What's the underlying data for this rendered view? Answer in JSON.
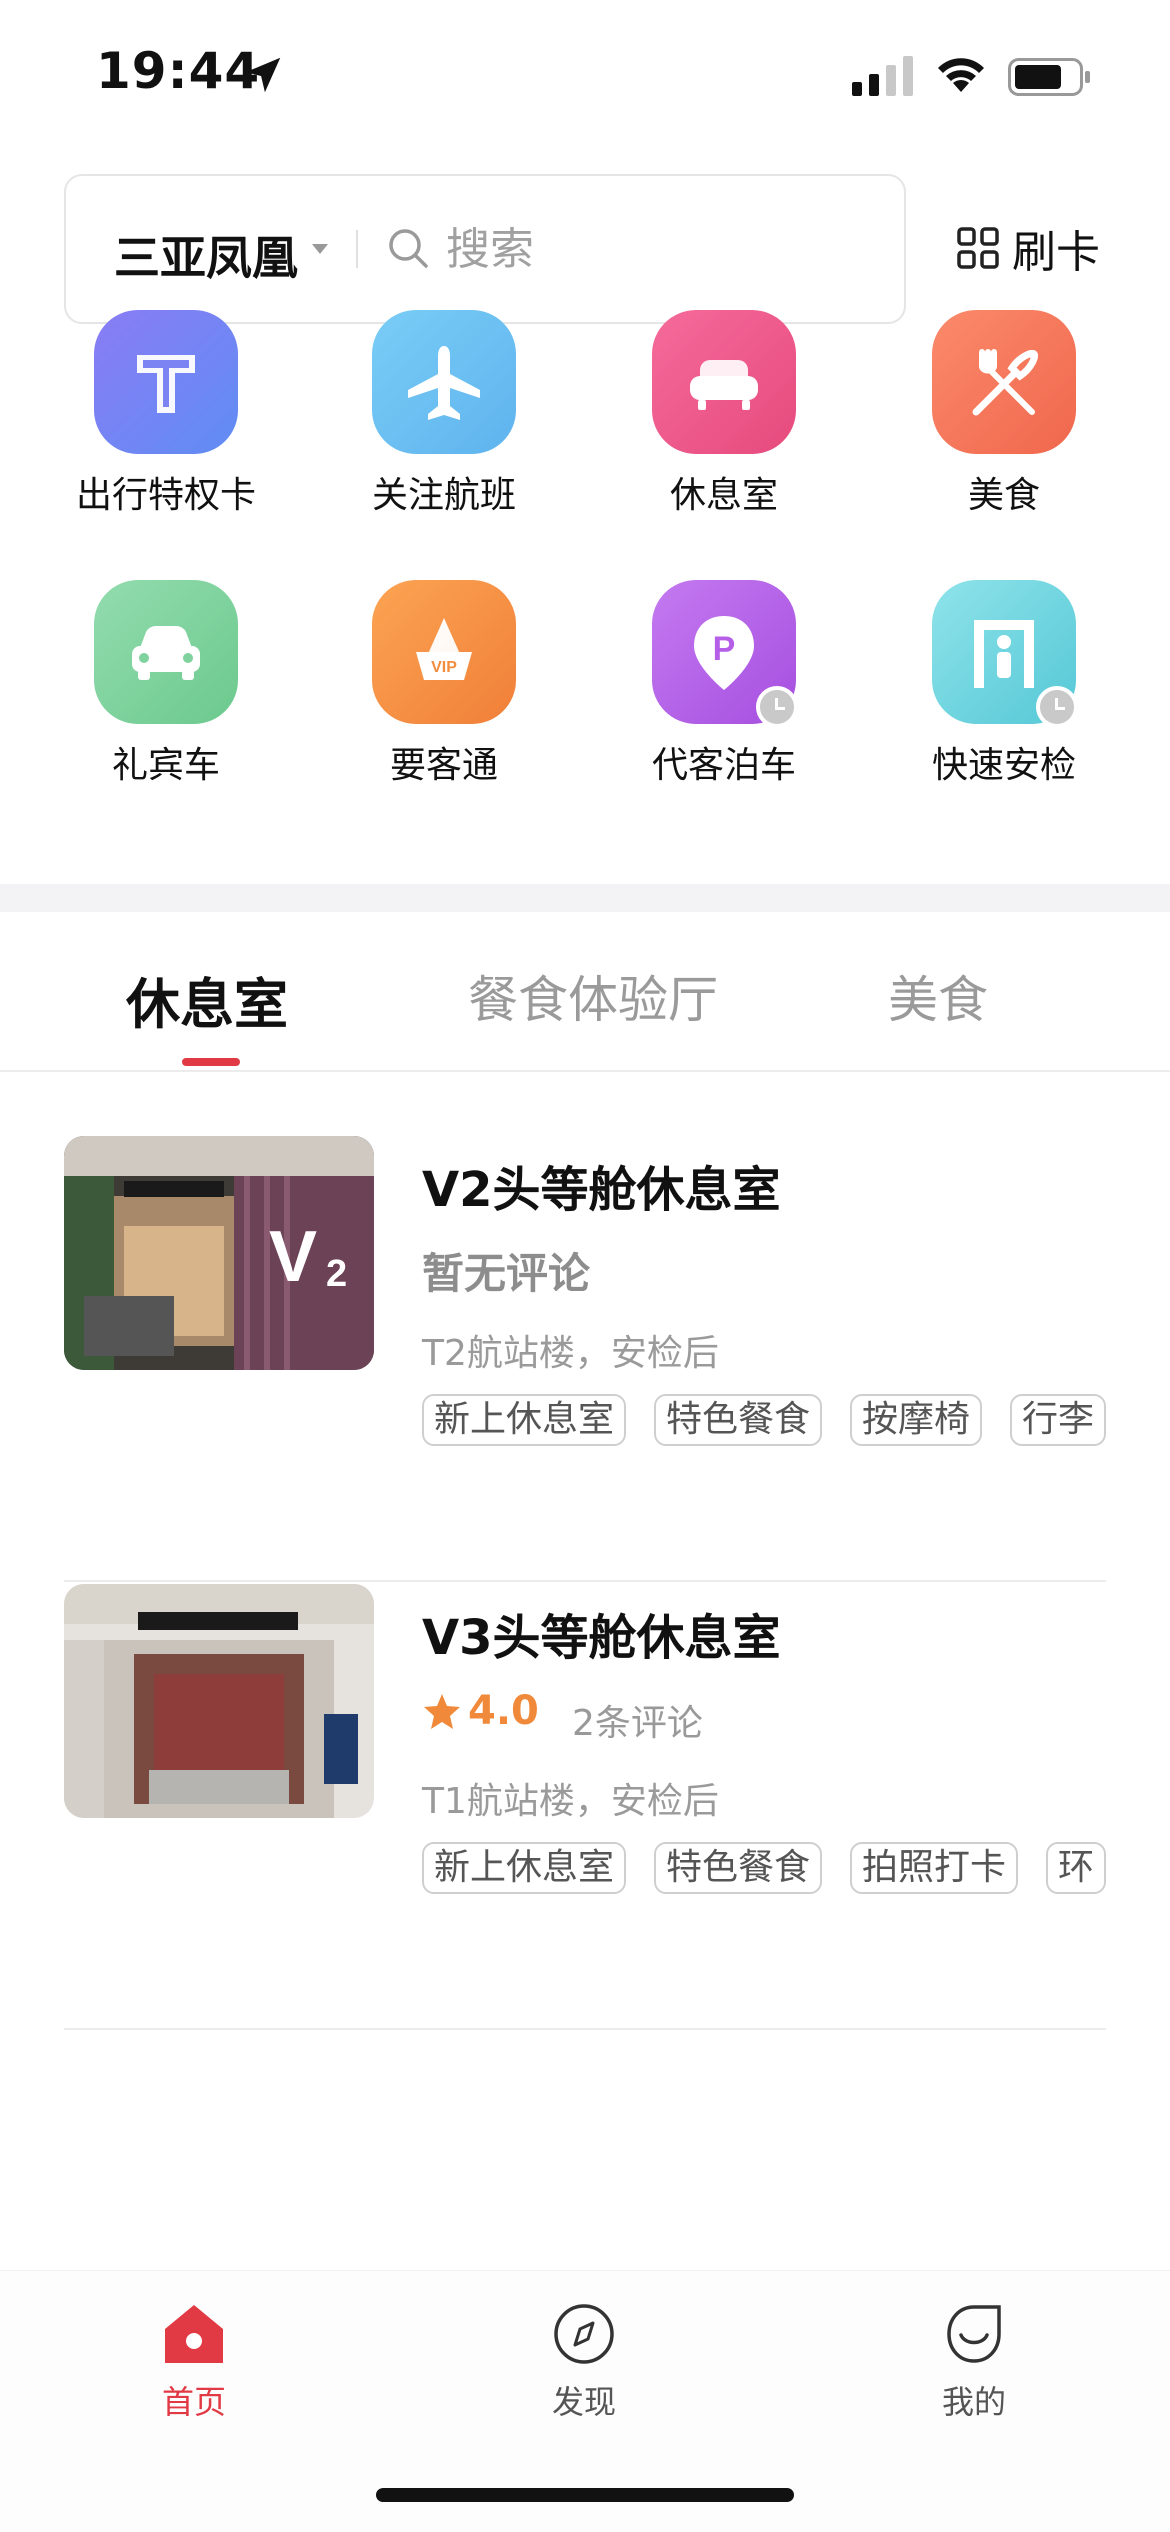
{
  "status_bar": {
    "time": "19:44"
  },
  "search": {
    "city": "三亚凤凰",
    "placeholder": "搜索",
    "card_button": "刷卡"
  },
  "quick_grid": [
    {
      "label": "出行特权卡",
      "icon": "t-card-icon"
    },
    {
      "label": "关注航班",
      "icon": "airplane-icon"
    },
    {
      "label": "休息室",
      "icon": "sofa-icon"
    },
    {
      "label": "美食",
      "icon": "fork-knife-icon"
    },
    {
      "label": "礼宾车",
      "icon": "car-icon"
    },
    {
      "label": "要客通",
      "icon": "vip-crown-icon"
    },
    {
      "label": "代客泊车",
      "icon": "parking-icon"
    },
    {
      "label": "快速安检",
      "icon": "security-gate-icon"
    }
  ],
  "tabs": [
    {
      "label": "休息室",
      "active": true
    },
    {
      "label": "餐食体验厅",
      "active": false
    },
    {
      "label": "美食",
      "active": false
    }
  ],
  "lounges": [
    {
      "name": "V2头等舱休息室",
      "review_text": "暂无评论",
      "location": "T2航站楼，安检后",
      "tags": [
        "新上休息室",
        "特色餐食",
        "按摩椅",
        "行李"
      ]
    },
    {
      "name": "V3头等舱休息室",
      "rating": "4.0",
      "review_count": "2条评论",
      "location": "T1航站楼，安检后",
      "tags": [
        "新上休息室",
        "特色餐食",
        "拍照打卡",
        "环"
      ]
    }
  ],
  "bottom_nav": [
    {
      "label": "首页",
      "icon": "home-icon",
      "active": true
    },
    {
      "label": "发现",
      "icon": "compass-icon",
      "active": false
    },
    {
      "label": "我的",
      "icon": "profile-smile-icon",
      "active": false
    }
  ],
  "colors": {
    "accent": "#e23a44",
    "rating": "#f08a3a"
  }
}
